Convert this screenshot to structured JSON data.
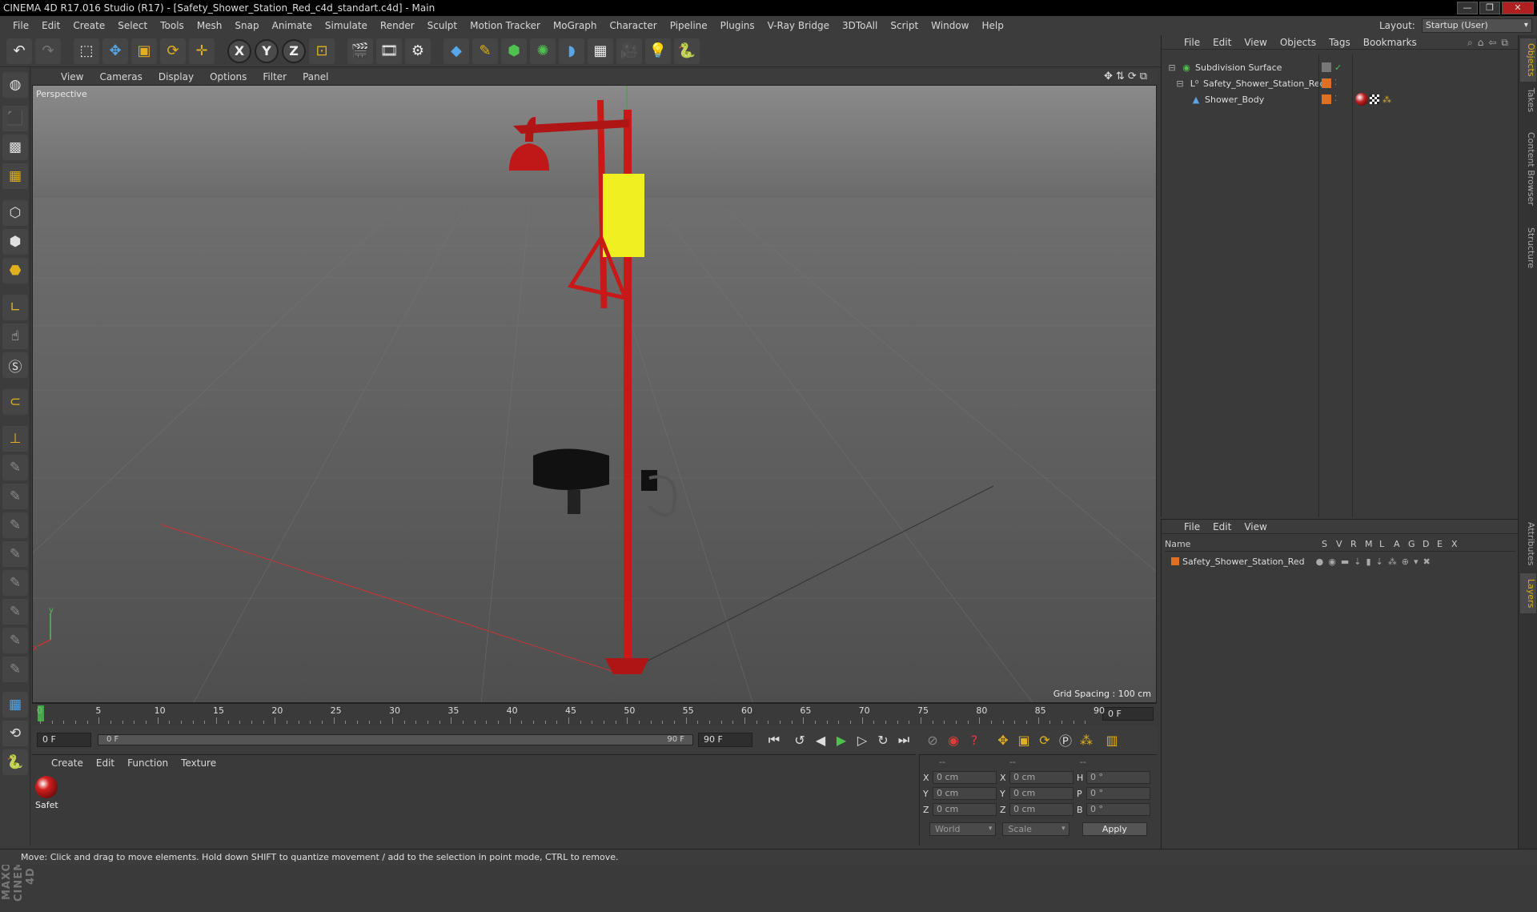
{
  "window": {
    "title": "CINEMA 4D R17.016 Studio (R17) - [Safety_Shower_Station_Red_c4d_standart.c4d] - Main",
    "buttons": [
      "—",
      "❐",
      "✕"
    ]
  },
  "menu": [
    "File",
    "Edit",
    "Create",
    "Select",
    "Tools",
    "Mesh",
    "Snap",
    "Animate",
    "Simulate",
    "Render",
    "Sculpt",
    "Motion Tracker",
    "MoGraph",
    "Character",
    "Pipeline",
    "Plugins",
    "V-Ray Bridge",
    "3DToAll",
    "Script",
    "Window",
    "Help"
  ],
  "layout": {
    "label": "Layout:",
    "value": "Startup (User)"
  },
  "viewport": {
    "menu": [
      "View",
      "Cameras",
      "Display",
      "Options",
      "Filter",
      "Panel"
    ],
    "label": "Perspective",
    "grid_spacing": "Grid Spacing : 100 cm",
    "axis": {
      "y": "y",
      "x": "x"
    }
  },
  "timeline": {
    "ticks": [
      "0",
      "5",
      "10",
      "15",
      "20",
      "25",
      "30",
      "35",
      "40",
      "45",
      "50",
      "55",
      "60",
      "65",
      "70",
      "75",
      "80",
      "85",
      "90"
    ],
    "current": "0 F"
  },
  "transport": {
    "start": "0 F",
    "range_start": "0 F",
    "range_end": "90 F",
    "end": "90 F"
  },
  "material_manager": {
    "menu": [
      "Create",
      "Edit",
      "Function",
      "Texture"
    ],
    "material_label": "Safet"
  },
  "coordinates": {
    "headers": [
      "--",
      "--",
      "--"
    ],
    "rows": [
      {
        "a": "X",
        "av": "0 cm",
        "b": "X",
        "bv": "0 cm",
        "c": "H",
        "cv": "0 °"
      },
      {
        "a": "Y",
        "av": "0 cm",
        "b": "Y",
        "bv": "0 cm",
        "c": "P",
        "cv": "0 °"
      },
      {
        "a": "Z",
        "av": "0 cm",
        "b": "Z",
        "bv": "0 cm",
        "c": "B",
        "cv": "0 °"
      }
    ],
    "mode": "World",
    "size_mode": "Scale",
    "apply": "Apply"
  },
  "objects": {
    "menu": [
      "File",
      "Edit",
      "View",
      "Objects",
      "Tags",
      "Bookmarks"
    ],
    "items": [
      {
        "name": "Subdivision Surface",
        "icon": "subdivision-icon"
      },
      {
        "name": "Safety_Shower_Station_Red",
        "icon": "null-icon"
      },
      {
        "name": "Shower_Body",
        "icon": "polygon-icon"
      }
    ]
  },
  "layers": {
    "menu": [
      "File",
      "Edit",
      "View"
    ],
    "headers": [
      "Name",
      "S",
      "V",
      "R",
      "M",
      "L",
      "A",
      "G",
      "D",
      "E",
      "X"
    ],
    "items": [
      {
        "name": "Safety_Shower_Station_Red",
        "color": "#e07020"
      }
    ]
  },
  "right_tabs": [
    "Objects",
    "Takes",
    "Content Browser",
    "Structure",
    "Attributes",
    "Layers"
  ],
  "status": "Move: Click and drag to move elements. Hold down SHIFT to quantize movement / add to the selection in point mode, CTRL to remove.",
  "brand": "MAXON CINEMA 4D",
  "colors": {
    "accent": "#e0b020",
    "model_red": "#c81818",
    "sign_yellow": "#f0f020"
  }
}
